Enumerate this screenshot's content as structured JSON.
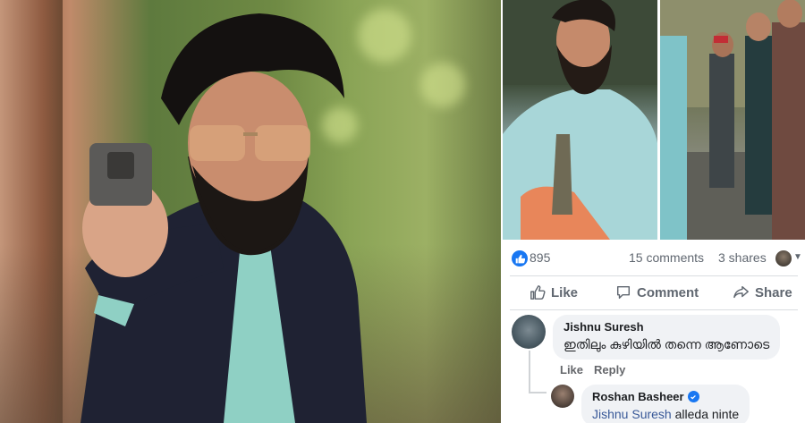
{
  "post": {
    "likes": "895",
    "comments_count": "15 comments",
    "shares_count": "3 shares"
  },
  "actions": {
    "like_label": "Like",
    "comment_label": "Comment",
    "share_label": "Share"
  },
  "comments": [
    {
      "author": "Jishnu Suresh",
      "text": "ഇതിലും കുഴിയിൽ തന്നെ ആണോടെ",
      "links": [
        "Like",
        "Reply"
      ]
    },
    {
      "author": "Roshan Basheer",
      "verified": true,
      "mention": "Jishnu Suresh",
      "text": "alleda ninte"
    }
  ],
  "colors": {
    "facebook_blue": "#1877f2",
    "muted_text": "#606770",
    "bubble_bg": "#f0f2f5",
    "mention": "#385898"
  },
  "icons": [
    "like-reaction-icon",
    "thumbs-up-icon",
    "comment-icon",
    "share-icon",
    "verified-badge-icon",
    "dropdown-caret-icon"
  ]
}
